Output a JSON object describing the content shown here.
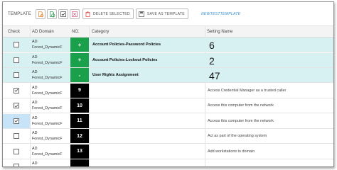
{
  "toolbar": {
    "label": "TEMPLATE",
    "icons": [
      "add-icon",
      "refresh-icon",
      "check-icon",
      "uncheck-icon"
    ],
    "delete_label": "DELETE SELECTED",
    "save_label": "SAVE AS TEMPLATE",
    "template_name": "NEWTESTTEMPLATE"
  },
  "columns": {
    "check": "Check",
    "domain": "AD Domain",
    "no": "NO.",
    "category": "Category",
    "setting": "Setting Name"
  },
  "rows": [
    {
      "type": "group",
      "checked": false,
      "domain_1": "AD",
      "domain_2": "Forest_DynamicF",
      "no": "+",
      "category": "Account Policies-Password Policies",
      "setting": "6"
    },
    {
      "type": "group",
      "checked": false,
      "domain_1": "AD",
      "domain_2": "Forest_DynamicF",
      "no": "+",
      "category": "Account Policies-Lockout Policies",
      "setting": "2"
    },
    {
      "type": "group",
      "checked": false,
      "domain_1": "AD",
      "domain_2": "Forest_DynamicF",
      "no": "-",
      "category": "User Rights Assignment",
      "setting": "47"
    },
    {
      "type": "item",
      "checked": true,
      "domain_1": "AD",
      "domain_2": "Forest_DynamicF",
      "no": "9",
      "category": "",
      "setting": "Access Credential Manager as a trusted caller"
    },
    {
      "type": "item",
      "checked": true,
      "domain_1": "AD",
      "domain_2": "Forest_DynamicF",
      "no": "10",
      "category": "",
      "setting": "Access this computer from the network"
    },
    {
      "type": "item",
      "checked": true,
      "domain_1": "AD",
      "domain_2": "Forest_DynamicF",
      "no": "11",
      "category": "",
      "setting": "Access this computer from the network"
    },
    {
      "type": "item",
      "checked": false,
      "domain_1": "AD",
      "domain_2": "Forest_DynamicF",
      "no": "12",
      "category": "",
      "setting": "Act as part of the operating system"
    },
    {
      "type": "item",
      "checked": false,
      "domain_1": "AD",
      "domain_2": "Forest_DynamicF",
      "no": "13",
      "category": "",
      "setting": "Add workstations to domain"
    },
    {
      "type": "item",
      "checked": false,
      "domain_1": "AD",
      "domain_2": "",
      "no": "",
      "category": "",
      "setting": ""
    }
  ],
  "colors": {
    "group_row": "#d7f0f2",
    "number_green": "#1aa04a",
    "number_black": "#000000",
    "active_check": "#c6e3f7",
    "template_link": "#3a8fd0",
    "check_mark": "#444444"
  }
}
